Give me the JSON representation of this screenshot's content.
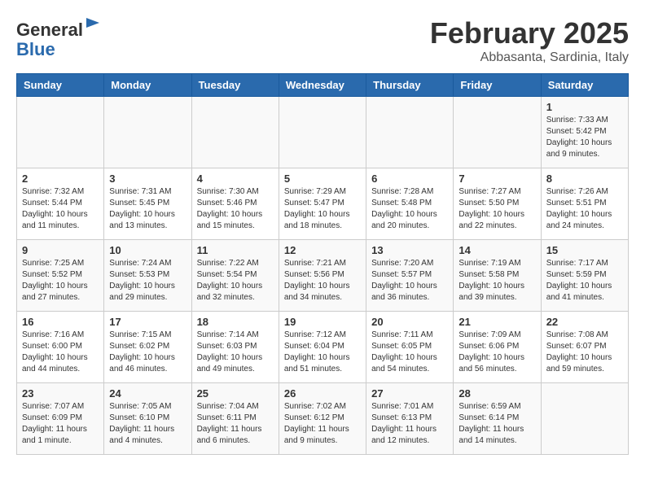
{
  "header": {
    "logo_general": "General",
    "logo_blue": "Blue",
    "month_title": "February 2025",
    "location": "Abbasanta, Sardinia, Italy"
  },
  "weekdays": [
    "Sunday",
    "Monday",
    "Tuesday",
    "Wednesday",
    "Thursday",
    "Friday",
    "Saturday"
  ],
  "weeks": [
    [
      {
        "day": "",
        "info": ""
      },
      {
        "day": "",
        "info": ""
      },
      {
        "day": "",
        "info": ""
      },
      {
        "day": "",
        "info": ""
      },
      {
        "day": "",
        "info": ""
      },
      {
        "day": "",
        "info": ""
      },
      {
        "day": "1",
        "info": "Sunrise: 7:33 AM\nSunset: 5:42 PM\nDaylight: 10 hours and 9 minutes."
      }
    ],
    [
      {
        "day": "2",
        "info": "Sunrise: 7:32 AM\nSunset: 5:44 PM\nDaylight: 10 hours and 11 minutes."
      },
      {
        "day": "3",
        "info": "Sunrise: 7:31 AM\nSunset: 5:45 PM\nDaylight: 10 hours and 13 minutes."
      },
      {
        "day": "4",
        "info": "Sunrise: 7:30 AM\nSunset: 5:46 PM\nDaylight: 10 hours and 15 minutes."
      },
      {
        "day": "5",
        "info": "Sunrise: 7:29 AM\nSunset: 5:47 PM\nDaylight: 10 hours and 18 minutes."
      },
      {
        "day": "6",
        "info": "Sunrise: 7:28 AM\nSunset: 5:48 PM\nDaylight: 10 hours and 20 minutes."
      },
      {
        "day": "7",
        "info": "Sunrise: 7:27 AM\nSunset: 5:50 PM\nDaylight: 10 hours and 22 minutes."
      },
      {
        "day": "8",
        "info": "Sunrise: 7:26 AM\nSunset: 5:51 PM\nDaylight: 10 hours and 24 minutes."
      }
    ],
    [
      {
        "day": "9",
        "info": "Sunrise: 7:25 AM\nSunset: 5:52 PM\nDaylight: 10 hours and 27 minutes."
      },
      {
        "day": "10",
        "info": "Sunrise: 7:24 AM\nSunset: 5:53 PM\nDaylight: 10 hours and 29 minutes."
      },
      {
        "day": "11",
        "info": "Sunrise: 7:22 AM\nSunset: 5:54 PM\nDaylight: 10 hours and 32 minutes."
      },
      {
        "day": "12",
        "info": "Sunrise: 7:21 AM\nSunset: 5:56 PM\nDaylight: 10 hours and 34 minutes."
      },
      {
        "day": "13",
        "info": "Sunrise: 7:20 AM\nSunset: 5:57 PM\nDaylight: 10 hours and 36 minutes."
      },
      {
        "day": "14",
        "info": "Sunrise: 7:19 AM\nSunset: 5:58 PM\nDaylight: 10 hours and 39 minutes."
      },
      {
        "day": "15",
        "info": "Sunrise: 7:17 AM\nSunset: 5:59 PM\nDaylight: 10 hours and 41 minutes."
      }
    ],
    [
      {
        "day": "16",
        "info": "Sunrise: 7:16 AM\nSunset: 6:00 PM\nDaylight: 10 hours and 44 minutes."
      },
      {
        "day": "17",
        "info": "Sunrise: 7:15 AM\nSunset: 6:02 PM\nDaylight: 10 hours and 46 minutes."
      },
      {
        "day": "18",
        "info": "Sunrise: 7:14 AM\nSunset: 6:03 PM\nDaylight: 10 hours and 49 minutes."
      },
      {
        "day": "19",
        "info": "Sunrise: 7:12 AM\nSunset: 6:04 PM\nDaylight: 10 hours and 51 minutes."
      },
      {
        "day": "20",
        "info": "Sunrise: 7:11 AM\nSunset: 6:05 PM\nDaylight: 10 hours and 54 minutes."
      },
      {
        "day": "21",
        "info": "Sunrise: 7:09 AM\nSunset: 6:06 PM\nDaylight: 10 hours and 56 minutes."
      },
      {
        "day": "22",
        "info": "Sunrise: 7:08 AM\nSunset: 6:07 PM\nDaylight: 10 hours and 59 minutes."
      }
    ],
    [
      {
        "day": "23",
        "info": "Sunrise: 7:07 AM\nSunset: 6:09 PM\nDaylight: 11 hours and 1 minute."
      },
      {
        "day": "24",
        "info": "Sunrise: 7:05 AM\nSunset: 6:10 PM\nDaylight: 11 hours and 4 minutes."
      },
      {
        "day": "25",
        "info": "Sunrise: 7:04 AM\nSunset: 6:11 PM\nDaylight: 11 hours and 6 minutes."
      },
      {
        "day": "26",
        "info": "Sunrise: 7:02 AM\nSunset: 6:12 PM\nDaylight: 11 hours and 9 minutes."
      },
      {
        "day": "27",
        "info": "Sunrise: 7:01 AM\nSunset: 6:13 PM\nDaylight: 11 hours and 12 minutes."
      },
      {
        "day": "28",
        "info": "Sunrise: 6:59 AM\nSunset: 6:14 PM\nDaylight: 11 hours and 14 minutes."
      },
      {
        "day": "",
        "info": ""
      }
    ]
  ]
}
